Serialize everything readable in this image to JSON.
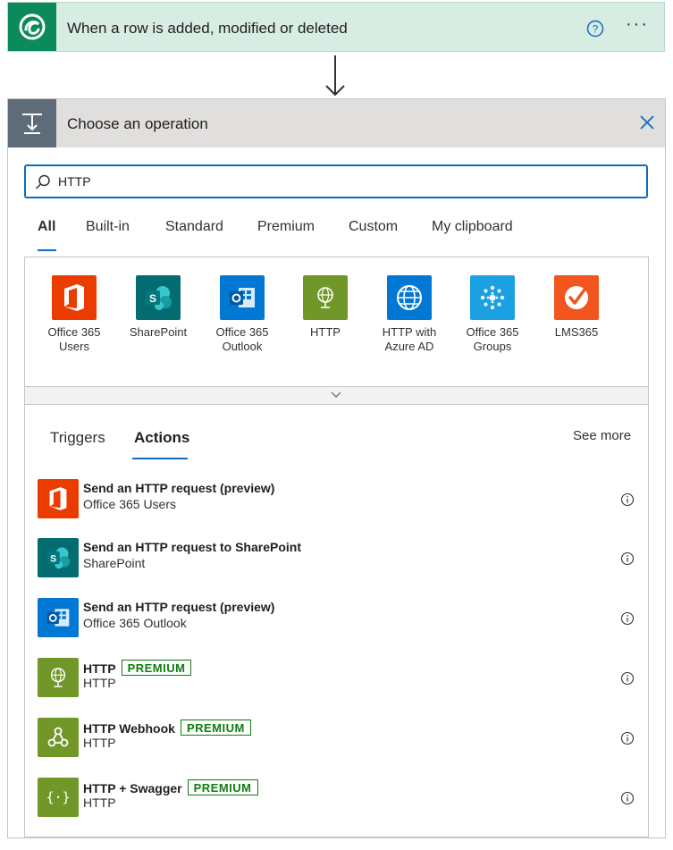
{
  "trigger": {
    "title": "When a row is added, modified or deleted",
    "more_label": "···"
  },
  "operation": {
    "title": "Choose an operation"
  },
  "search": {
    "value": "HTTP"
  },
  "tabs": [
    "All",
    "Built-in",
    "Standard",
    "Premium",
    "Custom",
    "My clipboard"
  ],
  "connectors": [
    {
      "name": "Office 365 Users",
      "line1": "Office 365",
      "line2": "Users",
      "icon": "office-icon",
      "color": "#eb3c00"
    },
    {
      "name": "SharePoint",
      "line1": "SharePoint",
      "line2": "",
      "icon": "sharepoint-icon",
      "color": "#036c70"
    },
    {
      "name": "Office 365 Outlook",
      "line1": "Office 365",
      "line2": "Outlook",
      "icon": "outlook-icon",
      "color": "#0078d4"
    },
    {
      "name": "HTTP",
      "line1": "HTTP",
      "line2": "",
      "icon": "http-globe-icon",
      "color": "#709727"
    },
    {
      "name": "HTTP with Azure AD",
      "line1": "HTTP with",
      "line2": "Azure AD",
      "icon": "globe-icon",
      "color": "#0078d4"
    },
    {
      "name": "Office 365 Groups",
      "line1": "Office 365",
      "line2": "Groups",
      "icon": "groups-icon",
      "color": "#1ba1e2"
    },
    {
      "name": "LMS365",
      "line1": "LMS365",
      "line2": "",
      "icon": "lms365-icon",
      "color": "#f0561d"
    }
  ],
  "subtabs": {
    "triggers": "Triggers",
    "actions": "Actions",
    "see_more": "See more"
  },
  "actions": [
    {
      "title": "Send an HTTP request (preview)",
      "subtitle": "Office 365 Users",
      "badge": "",
      "icon": "office-icon",
      "color": "#eb3c00"
    },
    {
      "title": "Send an HTTP request to SharePoint",
      "subtitle": "SharePoint",
      "badge": "",
      "icon": "sharepoint-icon",
      "color": "#036c70"
    },
    {
      "title": "Send an HTTP request (preview)",
      "subtitle": "Office 365 Outlook",
      "badge": "",
      "icon": "outlook-icon",
      "color": "#0078d4"
    },
    {
      "title": "HTTP",
      "subtitle": "HTTP",
      "badge": "PREMIUM",
      "icon": "http-globe-icon",
      "color": "#709727"
    },
    {
      "title": "HTTP Webhook",
      "subtitle": "HTTP",
      "badge": "PREMIUM",
      "icon": "webhook-icon",
      "color": "#709727"
    },
    {
      "title": "HTTP + Swagger",
      "subtitle": "HTTP",
      "badge": "PREMIUM",
      "icon": "swagger-icon",
      "color": "#709727"
    }
  ],
  "colors": {
    "accent": "#0f6cbd",
    "premium": "#107c10",
    "trigger_bg": "#d7ece2"
  }
}
